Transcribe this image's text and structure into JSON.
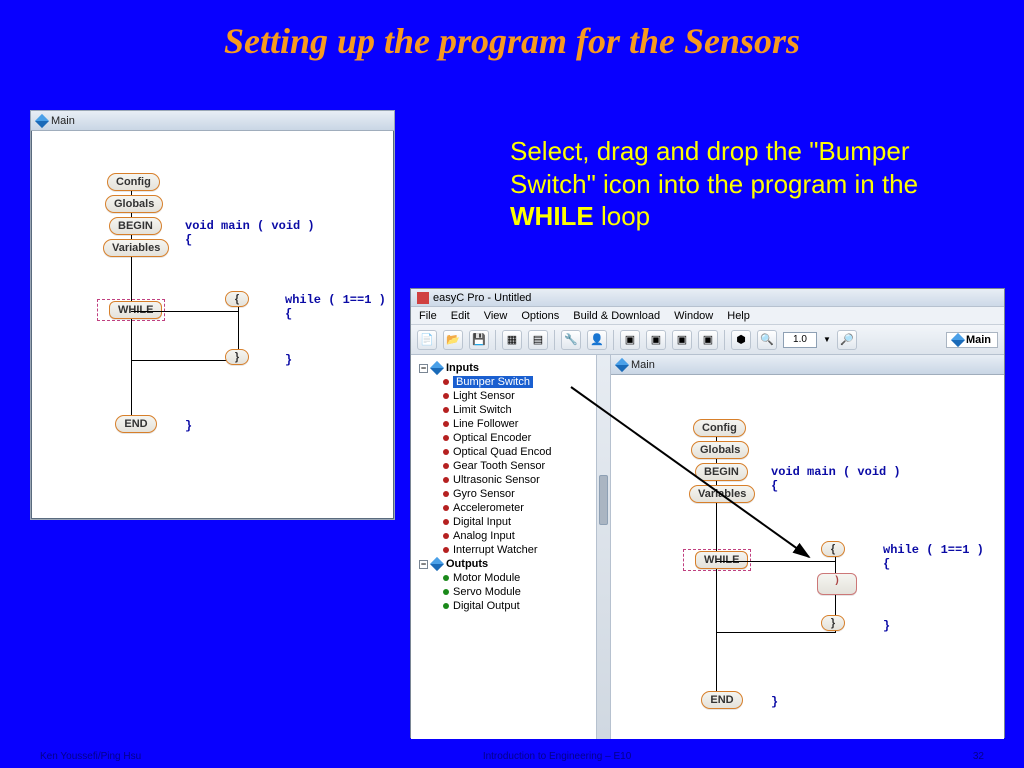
{
  "title": "Setting up the program for the Sensors",
  "instruction_pre": "Select, drag and drop the \"Bumper Switch\" icon into the program in the ",
  "instruction_bold": "WHILE",
  "instruction_post": " loop",
  "win1": {
    "title": "Main",
    "blocks": {
      "config": "Config",
      "globals": "Globals",
      "begin": "BEGIN",
      "variables": "Variables",
      "while": "WHILE",
      "end": "END",
      "lbrace": "{",
      "rbrace": "}"
    },
    "code": {
      "main": "void main ( void )\n{",
      "while": "while ( 1==1 )\n{",
      "close1": "}",
      "close2": "}"
    }
  },
  "win2": {
    "app_title": "easyC Pro - Untitled",
    "menu": [
      "File",
      "Edit",
      "View",
      "Options",
      "Build & Download",
      "Window",
      "Help"
    ],
    "zoom": "1.0",
    "maintab": "Main",
    "tree": {
      "group_inputs": "Inputs",
      "inputs": [
        "Bumper Switch",
        "Light Sensor",
        "Limit Switch",
        "Line Follower",
        "Optical Encoder",
        "Optical Quad Encod",
        "Gear Tooth Sensor",
        "Ultrasonic Sensor",
        "Gyro Sensor",
        "Accelerometer",
        "Digital Input",
        "Analog Input",
        "Interrupt Watcher"
      ],
      "group_outputs": "Outputs",
      "outputs": [
        "Motor Module",
        "Servo Module",
        "Digital Output"
      ]
    },
    "flow": {
      "title": "Main",
      "blocks": {
        "config": "Config",
        "globals": "Globals",
        "begin": "BEGIN",
        "variables": "Variables",
        "while": "WHILE",
        "end": "END",
        "lbrace": "{",
        "rbrace": "}"
      },
      "code": {
        "main": "void main ( void )\n{",
        "while": "while ( 1==1 )\n{",
        "close1": "}",
        "close2": "}"
      }
    }
  },
  "footer": {
    "left": "Ken Youssefi/Ping Hsu",
    "center": "Introduction to Engineering – E10",
    "right": "32"
  }
}
